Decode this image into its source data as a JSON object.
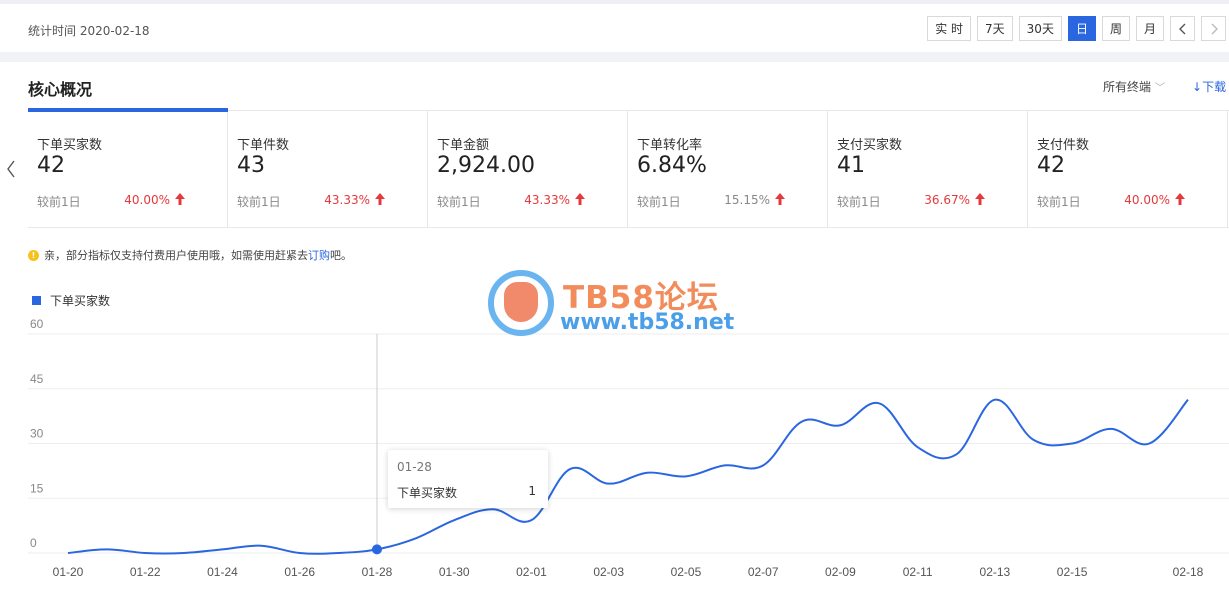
{
  "header": {
    "stat_time": "统计时间 2020-02-18",
    "time_buttons": [
      "实 时",
      "7天",
      "30天",
      "日",
      "周",
      "月"
    ],
    "active_button": "日",
    "prev_icon": "chevron-left-icon",
    "next_icon": "chevron-right-icon"
  },
  "section": {
    "title": "核心概况",
    "terminal_select": "所有终端",
    "download": "下载"
  },
  "cards": [
    {
      "label": "下单买家数",
      "value": "42",
      "compare": "较前1日",
      "pct": "40.00%",
      "trend": "up"
    },
    {
      "label": "下单件数",
      "value": "43",
      "compare": "较前1日",
      "pct": "43.33%",
      "trend": "up"
    },
    {
      "label": "下单金额",
      "value": "2,924.00",
      "compare": "较前1日",
      "pct": "43.33%",
      "trend": "up"
    },
    {
      "label": "下单转化率",
      "value": "6.84%",
      "compare": "较前1日",
      "pct": "15.15%",
      "trend": "up"
    },
    {
      "label": "支付买家数",
      "value": "41",
      "compare": "较前1日",
      "pct": "36.67%",
      "trend": "up"
    },
    {
      "label": "支付件数",
      "value": "42",
      "compare": "较前1日",
      "pct": "40.00%",
      "trend": "up"
    }
  ],
  "notice": {
    "prefix": "亲，部分指标仅支持付费用户使用哦，如需使用赶紧去 ",
    "link": "订购",
    "suffix": "吧。"
  },
  "watermark": {
    "title": "TB58论坛",
    "url": "www.tb58.net"
  },
  "tooltip": {
    "date": "01-28",
    "name": "下单买家数",
    "value": "1"
  },
  "colors": {
    "accent": "#2a66e0",
    "up": "#e4393c"
  },
  "chart_data": {
    "type": "line",
    "series": [
      {
        "name": "下单买家数",
        "values": [
          0,
          1,
          0,
          0,
          1,
          2,
          0,
          0,
          1,
          4,
          9,
          12,
          9,
          23,
          19,
          22,
          21,
          24,
          24,
          36,
          35,
          41,
          29,
          27,
          42,
          31,
          30,
          34,
          30,
          42
        ]
      }
    ],
    "x": [
      "01-20",
      "01-21",
      "01-22",
      "01-23",
      "01-24",
      "01-25",
      "01-26",
      "01-27",
      "01-28",
      "01-29",
      "01-30",
      "01-31",
      "02-01",
      "02-02",
      "02-03",
      "02-04",
      "02-05",
      "02-06",
      "02-07",
      "02-08",
      "02-09",
      "02-10",
      "02-11",
      "02-12",
      "02-13",
      "02-14",
      "02-15",
      "02-16",
      "02-17",
      "02-18"
    ],
    "x_tick_labels": [
      "01-20",
      "01-22",
      "01-24",
      "01-26",
      "01-28",
      "01-30",
      "02-01",
      "02-03",
      "02-05",
      "02-07",
      "02-09",
      "02-11",
      "02-13",
      "02-15",
      "02-18"
    ],
    "y_ticks": [
      0,
      15,
      30,
      45,
      60
    ],
    "ylim": [
      0,
      60
    ],
    "grid": true,
    "legend": "top-left",
    "highlight_index": 8
  }
}
